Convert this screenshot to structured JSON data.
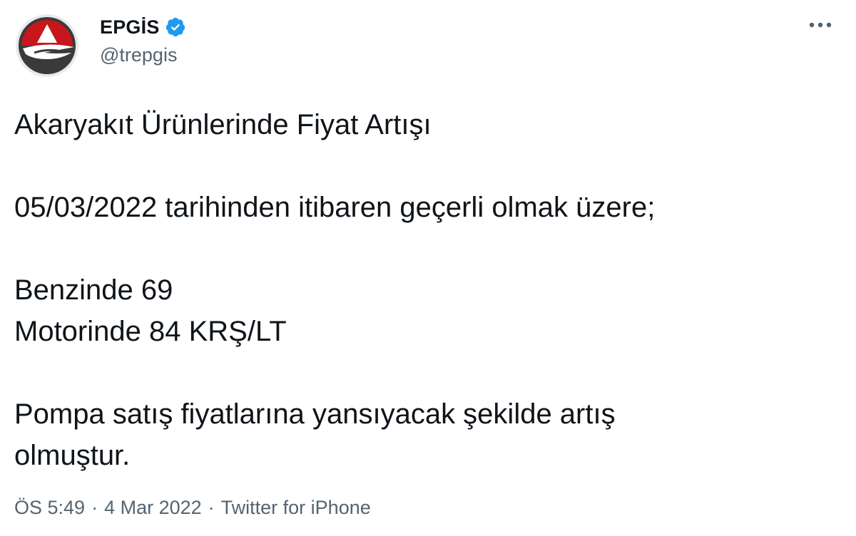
{
  "author": {
    "name": "EPGİS",
    "handle": "@trepgis",
    "verified": true,
    "avatar_icon": "epgis-logo-icon"
  },
  "more_menu": {
    "icon": "more-options-icon",
    "label": "···"
  },
  "tweet": {
    "line1": "Akaryakıt Ürünlerinde Fiyat Artışı",
    "line2": "05/03/2022 tarihinden itibaren geçerli olmak üzere;",
    "line3": "Benzinde 69",
    "line4": "Motorinde 84 KRŞ/LT",
    "line5": "Pompa satış fiyatlarına yansıyacak şekilde artış",
    "line6": "olmuştur."
  },
  "meta": {
    "time": "ÖS 5:49",
    "separator": "·",
    "date": "4 Mar 2022",
    "source": "Twitter for iPhone"
  },
  "colors": {
    "text": "#0f1419",
    "secondary": "#536471",
    "verified": "#1d9bf0",
    "logo_red": "#c8161d",
    "logo_dark": "#3a3a3a"
  }
}
